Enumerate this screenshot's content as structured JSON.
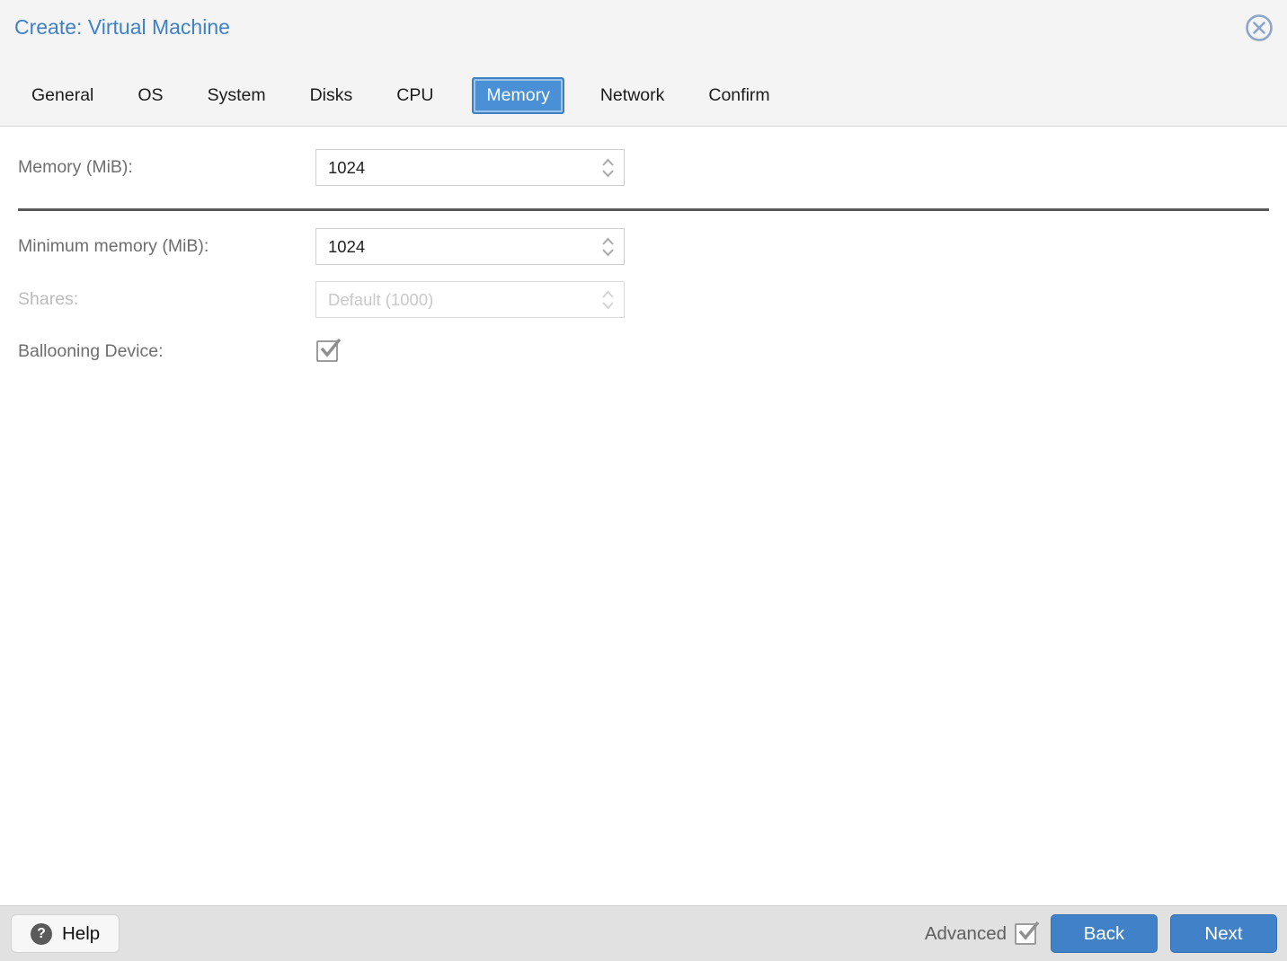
{
  "dialog": {
    "title": "Create: Virtual Machine"
  },
  "tabs": [
    {
      "label": "General",
      "active": false
    },
    {
      "label": "OS",
      "active": false
    },
    {
      "label": "System",
      "active": false
    },
    {
      "label": "Disks",
      "active": false
    },
    {
      "label": "CPU",
      "active": false
    },
    {
      "label": "Memory",
      "active": true
    },
    {
      "label": "Network",
      "active": false
    },
    {
      "label": "Confirm",
      "active": false
    }
  ],
  "form": {
    "memory": {
      "label": "Memory (MiB):",
      "value": "1024"
    },
    "min_memory": {
      "label": "Minimum memory (MiB):",
      "value": "1024"
    },
    "shares": {
      "label": "Shares:",
      "placeholder": "Default (1000)",
      "disabled": true
    },
    "ballooning": {
      "label": "Ballooning Device:",
      "checked": true
    }
  },
  "footer": {
    "help_label": "Help",
    "help_icon_glyph": "?",
    "advanced_label": "Advanced",
    "advanced_checked": true,
    "back_label": "Back",
    "next_label": "Next"
  },
  "colors": {
    "title_blue": "#3f81c7",
    "active_tab_blue": "#4a90d6",
    "button_blue": "#4181c8",
    "header_gray": "#f4f4f4",
    "footer_gray": "#e1e1e1",
    "divider_gray": "#595959",
    "label_gray": "#6e6e6e",
    "disabled_gray": "#bcbcbc"
  }
}
